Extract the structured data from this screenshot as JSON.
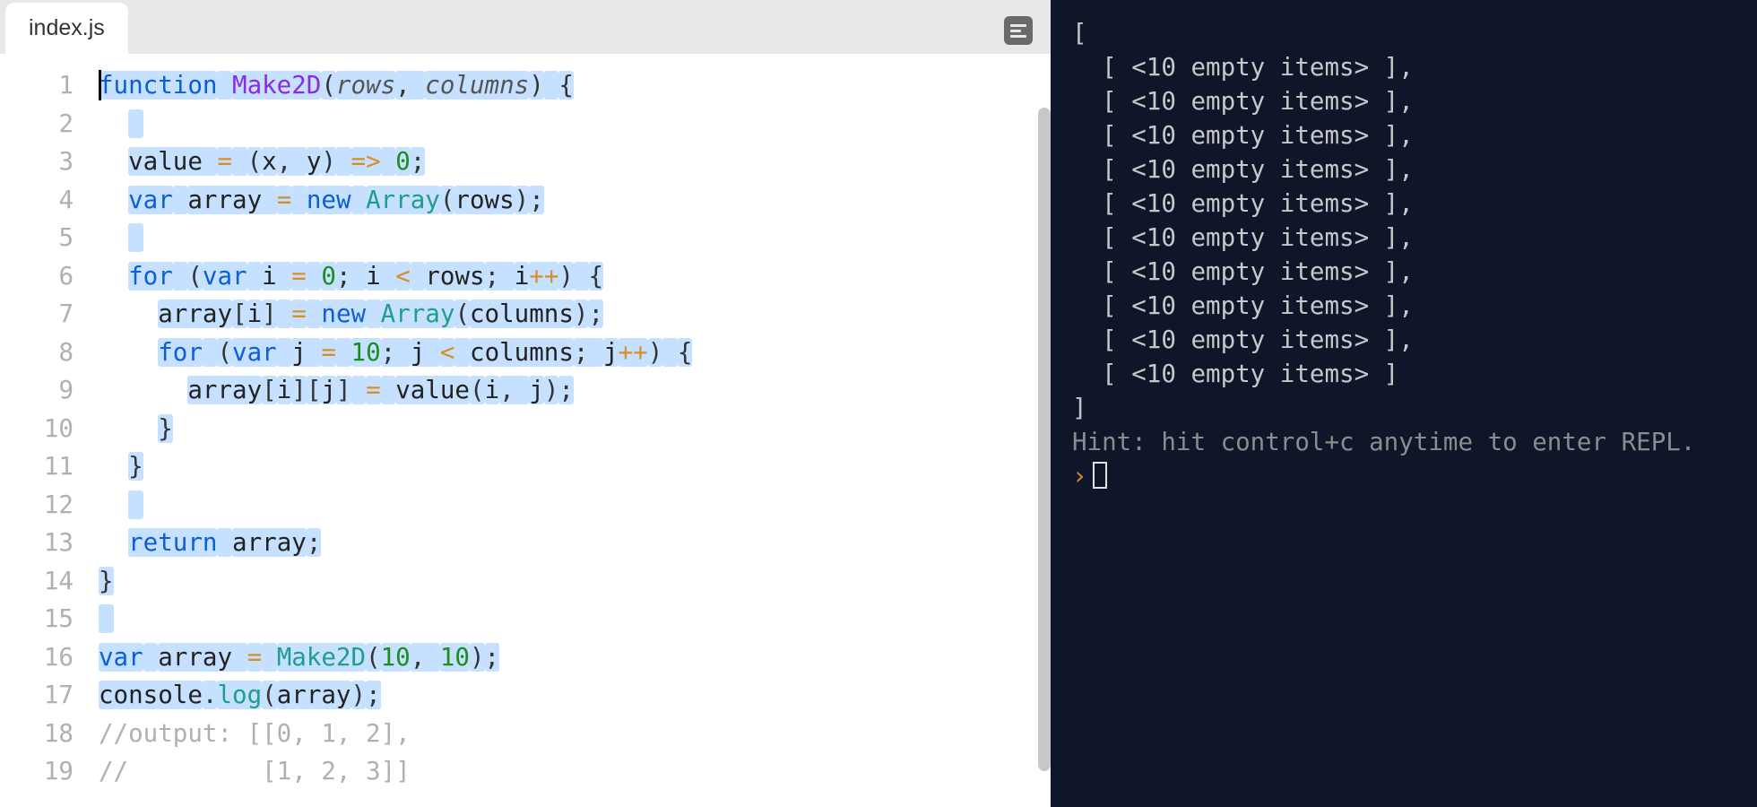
{
  "tab": {
    "filename": "index.js"
  },
  "gutter": {
    "start": 1,
    "end": 19
  },
  "code": {
    "lines": [
      [
        {
          "cls": "kw sel",
          "txt": "function"
        },
        {
          "cls": "sel",
          "txt": " "
        },
        {
          "cls": "fn sel",
          "txt": "Make2D"
        },
        {
          "cls": "punct sel",
          "txt": "("
        },
        {
          "cls": "param sel",
          "txt": "rows"
        },
        {
          "cls": "punct sel",
          "txt": ", "
        },
        {
          "cls": "param sel",
          "txt": "columns"
        },
        {
          "cls": "punct sel",
          "txt": ")"
        },
        {
          "cls": "sel",
          "txt": " "
        },
        {
          "cls": "punct sel",
          "txt": "{"
        }
      ],
      [
        {
          "cls": "",
          "txt": "  "
        },
        {
          "cls": "sel",
          "txt": " "
        }
      ],
      [
        {
          "cls": "",
          "txt": "  "
        },
        {
          "cls": "ident sel",
          "txt": "value "
        },
        {
          "cls": "op sel",
          "txt": "="
        },
        {
          "cls": "sel",
          "txt": " "
        },
        {
          "cls": "punct sel",
          "txt": "("
        },
        {
          "cls": "ident sel",
          "txt": "x"
        },
        {
          "cls": "punct sel",
          "txt": ", "
        },
        {
          "cls": "ident sel",
          "txt": "y"
        },
        {
          "cls": "punct sel",
          "txt": ")"
        },
        {
          "cls": "sel",
          "txt": " "
        },
        {
          "cls": "op sel",
          "txt": "=>"
        },
        {
          "cls": "sel",
          "txt": " "
        },
        {
          "cls": "num sel",
          "txt": "0"
        },
        {
          "cls": "punct sel",
          "txt": ";"
        }
      ],
      [
        {
          "cls": "",
          "txt": "  "
        },
        {
          "cls": "kw sel",
          "txt": "var"
        },
        {
          "cls": "sel",
          "txt": " "
        },
        {
          "cls": "ident sel",
          "txt": "array "
        },
        {
          "cls": "op sel",
          "txt": "="
        },
        {
          "cls": "sel",
          "txt": " "
        },
        {
          "cls": "kw sel",
          "txt": "new"
        },
        {
          "cls": "sel",
          "txt": " "
        },
        {
          "cls": "cls sel",
          "txt": "Array"
        },
        {
          "cls": "punct sel",
          "txt": "("
        },
        {
          "cls": "ident sel",
          "txt": "rows"
        },
        {
          "cls": "punct sel",
          "txt": ")"
        },
        {
          "cls": "punct sel",
          "txt": ";"
        }
      ],
      [
        {
          "cls": "",
          "txt": "  "
        },
        {
          "cls": "sel",
          "txt": " "
        }
      ],
      [
        {
          "cls": "",
          "txt": "  "
        },
        {
          "cls": "kw sel",
          "txt": "for"
        },
        {
          "cls": "sel",
          "txt": " "
        },
        {
          "cls": "punct sel",
          "txt": "("
        },
        {
          "cls": "kw sel",
          "txt": "var"
        },
        {
          "cls": "sel",
          "txt": " "
        },
        {
          "cls": "ident sel",
          "txt": "i "
        },
        {
          "cls": "op sel",
          "txt": "="
        },
        {
          "cls": "sel",
          "txt": " "
        },
        {
          "cls": "num sel",
          "txt": "0"
        },
        {
          "cls": "punct sel",
          "txt": "; "
        },
        {
          "cls": "ident sel",
          "txt": "i "
        },
        {
          "cls": "op sel",
          "txt": "<"
        },
        {
          "cls": "sel",
          "txt": " "
        },
        {
          "cls": "ident sel",
          "txt": "rows"
        },
        {
          "cls": "punct sel",
          "txt": "; "
        },
        {
          "cls": "ident sel",
          "txt": "i"
        },
        {
          "cls": "op sel",
          "txt": "++"
        },
        {
          "cls": "punct sel",
          "txt": ")"
        },
        {
          "cls": "sel",
          "txt": " "
        },
        {
          "cls": "punct sel",
          "txt": "{"
        }
      ],
      [
        {
          "cls": "",
          "txt": "    "
        },
        {
          "cls": "ident sel",
          "txt": "array"
        },
        {
          "cls": "punct sel",
          "txt": "["
        },
        {
          "cls": "ident sel",
          "txt": "i"
        },
        {
          "cls": "punct sel",
          "txt": "]"
        },
        {
          "cls": "sel",
          "txt": " "
        },
        {
          "cls": "op sel",
          "txt": "="
        },
        {
          "cls": "sel",
          "txt": " "
        },
        {
          "cls": "kw sel",
          "txt": "new"
        },
        {
          "cls": "sel",
          "txt": " "
        },
        {
          "cls": "cls sel",
          "txt": "Array"
        },
        {
          "cls": "punct sel",
          "txt": "("
        },
        {
          "cls": "ident sel",
          "txt": "columns"
        },
        {
          "cls": "punct sel",
          "txt": ")"
        },
        {
          "cls": "punct sel",
          "txt": ";"
        }
      ],
      [
        {
          "cls": "",
          "txt": "    "
        },
        {
          "cls": "kw sel",
          "txt": "for"
        },
        {
          "cls": "sel",
          "txt": " "
        },
        {
          "cls": "punct sel",
          "txt": "("
        },
        {
          "cls": "kw sel",
          "txt": "var"
        },
        {
          "cls": "sel",
          "txt": " "
        },
        {
          "cls": "ident sel",
          "txt": "j "
        },
        {
          "cls": "op sel",
          "txt": "="
        },
        {
          "cls": "sel",
          "txt": " "
        },
        {
          "cls": "num sel",
          "txt": "10"
        },
        {
          "cls": "punct sel",
          "txt": "; "
        },
        {
          "cls": "ident sel",
          "txt": "j "
        },
        {
          "cls": "op sel",
          "txt": "<"
        },
        {
          "cls": "sel",
          "txt": " "
        },
        {
          "cls": "ident sel",
          "txt": "columns"
        },
        {
          "cls": "punct sel",
          "txt": "; "
        },
        {
          "cls": "ident sel",
          "txt": "j"
        },
        {
          "cls": "op sel",
          "txt": "++"
        },
        {
          "cls": "punct sel",
          "txt": ")"
        },
        {
          "cls": "sel",
          "txt": " "
        },
        {
          "cls": "punct sel",
          "txt": "{"
        }
      ],
      [
        {
          "cls": "",
          "txt": "      "
        },
        {
          "cls": "ident sel",
          "txt": "array"
        },
        {
          "cls": "punct sel",
          "txt": "["
        },
        {
          "cls": "ident sel",
          "txt": "i"
        },
        {
          "cls": "punct sel",
          "txt": "]"
        },
        {
          "cls": "punct sel",
          "txt": "["
        },
        {
          "cls": "ident sel",
          "txt": "j"
        },
        {
          "cls": "punct sel",
          "txt": "]"
        },
        {
          "cls": "sel",
          "txt": " "
        },
        {
          "cls": "op sel",
          "txt": "="
        },
        {
          "cls": "sel",
          "txt": " "
        },
        {
          "cls": "ident sel",
          "txt": "value"
        },
        {
          "cls": "punct sel",
          "txt": "("
        },
        {
          "cls": "ident sel",
          "txt": "i"
        },
        {
          "cls": "punct sel",
          "txt": ", "
        },
        {
          "cls": "ident sel",
          "txt": "j"
        },
        {
          "cls": "punct sel",
          "txt": ")"
        },
        {
          "cls": "punct sel",
          "txt": ";"
        }
      ],
      [
        {
          "cls": "",
          "txt": "    "
        },
        {
          "cls": "punct sel",
          "txt": "}"
        }
      ],
      [
        {
          "cls": "",
          "txt": "  "
        },
        {
          "cls": "punct sel",
          "txt": "}"
        }
      ],
      [
        {
          "cls": "",
          "txt": "  "
        },
        {
          "cls": "sel",
          "txt": " "
        }
      ],
      [
        {
          "cls": "",
          "txt": "  "
        },
        {
          "cls": "kw sel",
          "txt": "return"
        },
        {
          "cls": "sel",
          "txt": " "
        },
        {
          "cls": "ident sel",
          "txt": "array"
        },
        {
          "cls": "punct sel",
          "txt": ";"
        }
      ],
      [
        {
          "cls": "punct sel",
          "txt": "}"
        }
      ],
      [
        {
          "cls": "sel",
          "txt": " "
        }
      ],
      [
        {
          "cls": "kw sel",
          "txt": "var"
        },
        {
          "cls": "sel",
          "txt": " "
        },
        {
          "cls": "ident sel",
          "txt": "array "
        },
        {
          "cls": "op sel",
          "txt": "="
        },
        {
          "cls": "sel",
          "txt": " "
        },
        {
          "cls": "cls sel",
          "txt": "Make2D"
        },
        {
          "cls": "punct sel",
          "txt": "("
        },
        {
          "cls": "num sel",
          "txt": "10"
        },
        {
          "cls": "punct sel",
          "txt": ", "
        },
        {
          "cls": "num sel",
          "txt": "10"
        },
        {
          "cls": "punct sel",
          "txt": ")"
        },
        {
          "cls": "punct sel",
          "txt": ";"
        }
      ],
      [
        {
          "cls": "ident sel",
          "txt": "console"
        },
        {
          "cls": "punct sel",
          "txt": "."
        },
        {
          "cls": "cls sel",
          "txt": "log"
        },
        {
          "cls": "punct sel",
          "txt": "("
        },
        {
          "cls": "ident sel",
          "txt": "array"
        },
        {
          "cls": "punct sel",
          "txt": ")"
        },
        {
          "cls": "punct sel",
          "txt": ";"
        }
      ],
      [
        {
          "cls": "cmt",
          "txt": "//output: [[0, 1, 2],"
        }
      ],
      [
        {
          "cls": "cmt",
          "txt": "//         [1, 2, 3]]"
        }
      ]
    ]
  },
  "terminal": {
    "open_bracket": "[",
    "rows": [
      "  [ <10 empty items> ],",
      "  [ <10 empty items> ],",
      "  [ <10 empty items> ],",
      "  [ <10 empty items> ],",
      "  [ <10 empty items> ],",
      "  [ <10 empty items> ],",
      "  [ <10 empty items> ],",
      "  [ <10 empty items> ],",
      "  [ <10 empty items> ],",
      "  [ <10 empty items> ]"
    ],
    "close_bracket": "]",
    "hint": "Hint: hit control+c anytime to enter REPL.",
    "prompt": "›"
  }
}
